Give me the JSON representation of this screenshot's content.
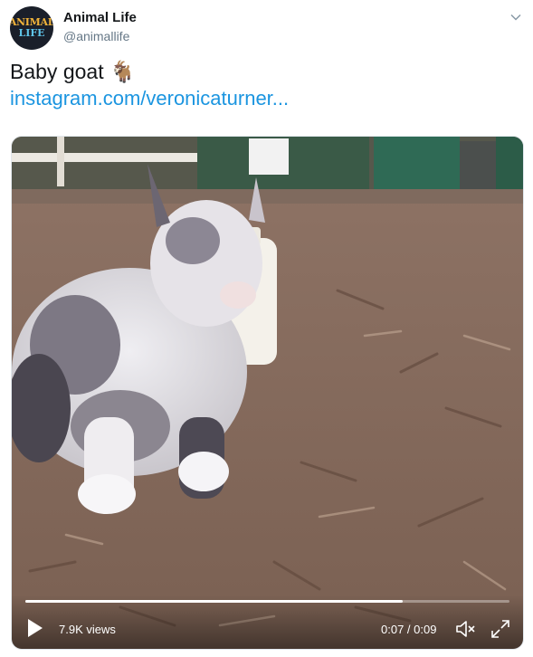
{
  "account": {
    "avatar_line1": "ANIMAL",
    "avatar_line2": "LIFE",
    "name": "Animal Life",
    "handle": "@animallife"
  },
  "tweet": {
    "text": "Baby goat 🐐",
    "link": "instagram.com/veronicaturner..."
  },
  "icons": {
    "menu": "chevron-down-icon",
    "play": "play-icon",
    "mute": "volume-muted-icon",
    "fullscreen": "fullscreen-icon"
  },
  "video": {
    "views": "7.9K views",
    "time": "0:07 / 0:09",
    "progress": 0.78
  },
  "colors": {
    "link": "#1b95e0",
    "text": "#14171a",
    "secondary": "#657786"
  }
}
